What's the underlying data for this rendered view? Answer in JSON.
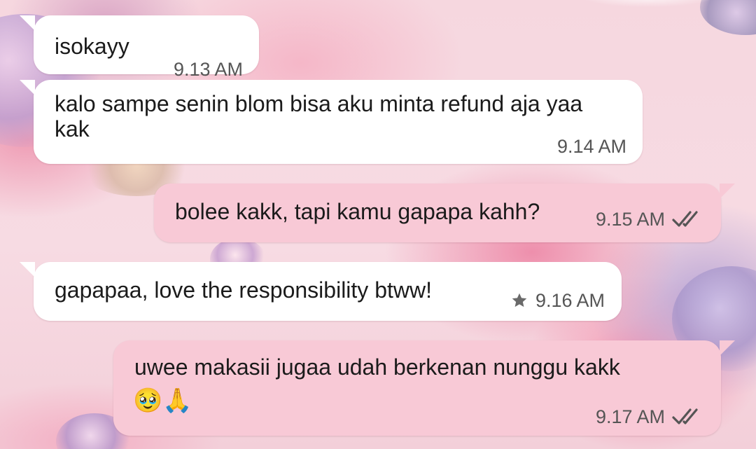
{
  "chat": {
    "messages": [
      {
        "direction": "incoming",
        "text": "isokayy",
        "time": "9.13 AM"
      },
      {
        "direction": "incoming",
        "text": "kalo sampe senin blom bisa aku minta refund aja yaa kak",
        "time": "9.14 AM"
      },
      {
        "direction": "outgoing",
        "text": "bolee kakk, tapi kamu gapapa kahh?",
        "time": "9.15 AM",
        "status_icon": "double-check-icon"
      },
      {
        "direction": "incoming",
        "text": "gapapaa, love the responsibility btww!",
        "time": "9.16 AM",
        "starred": true,
        "star_icon": "star-icon"
      },
      {
        "direction": "outgoing",
        "text": "uwee makasii jugaa udah berkenan nunggu kakk",
        "emoji": "🥹🙏",
        "time": "9.17 AM",
        "status_icon": "double-check-icon"
      }
    ]
  },
  "colors": {
    "incoming_bubble": "#ffffff",
    "outgoing_bubble": "#f8c9d6",
    "timestamp": "#555555",
    "text": "#1b1b1b"
  }
}
